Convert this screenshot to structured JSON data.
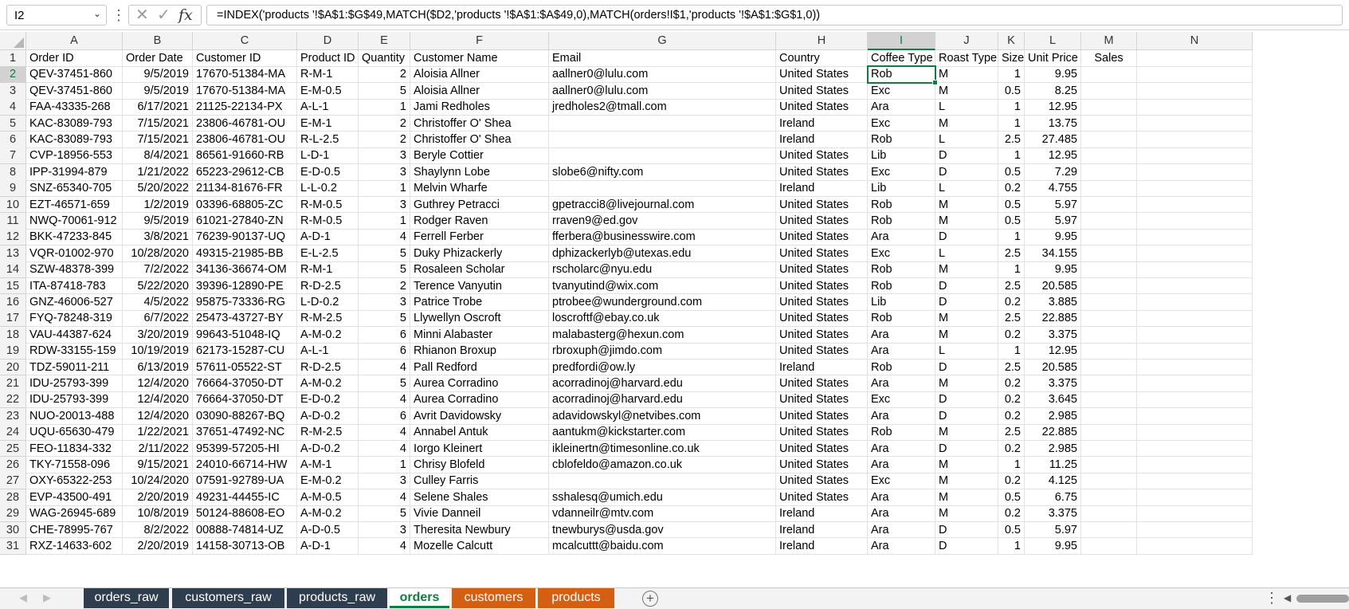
{
  "formula_bar": {
    "name_box": "I2",
    "formula": "=INDEX('products '!$A$1:$G$49,MATCH($D2,'products '!$A$1:$A$49,0),MATCH(orders!I$1,'products '!$A$1:$G$1,0))"
  },
  "icons": {
    "name_box_caret": "⌄",
    "more": "⋮",
    "cancel": "✕",
    "enter": "✓",
    "fx": "fx",
    "nav_prev": "◀",
    "nav_next": "▶",
    "add_sheet": "+",
    "tabs_more": "⋮",
    "scroll_left": "◀"
  },
  "grid": {
    "columns": [
      "A",
      "B",
      "C",
      "D",
      "E",
      "F",
      "G",
      "H",
      "I",
      "J",
      "K",
      "L",
      "M",
      "N"
    ],
    "selected_column": "I",
    "selected_row": 2,
    "header": [
      "Order ID",
      "Order Date",
      "Customer ID",
      "Product ID",
      "Quantity",
      "Customer Name",
      "Email",
      "Country",
      "Coffee Type",
      "Roast Type",
      "Size",
      "Unit Price",
      "Sales"
    ],
    "rows": [
      [
        "QEV-37451-860",
        "9/5/2019",
        "17670-51384-MA",
        "R-M-1",
        "2",
        "Aloisia Allner",
        "aallner0@lulu.com",
        "United States",
        "Rob",
        "M",
        "1",
        "9.95"
      ],
      [
        "QEV-37451-860",
        "9/5/2019",
        "17670-51384-MA",
        "E-M-0.5",
        "5",
        "Aloisia Allner",
        "aallner0@lulu.com",
        "United States",
        "Exc",
        "M",
        "0.5",
        "8.25"
      ],
      [
        "FAA-43335-268",
        "6/17/2021",
        "21125-22134-PX",
        "A-L-1",
        "1",
        "Jami Redholes",
        "jredholes2@tmall.com",
        "United States",
        "Ara",
        "L",
        "1",
        "12.95"
      ],
      [
        "KAC-83089-793",
        "7/15/2021",
        "23806-46781-OU",
        "E-M-1",
        "2",
        "Christoffer O' Shea",
        "",
        "Ireland",
        "Exc",
        "M",
        "1",
        "13.75"
      ],
      [
        "KAC-83089-793",
        "7/15/2021",
        "23806-46781-OU",
        "R-L-2.5",
        "2",
        "Christoffer O' Shea",
        "",
        "Ireland",
        "Rob",
        "L",
        "2.5",
        "27.485"
      ],
      [
        "CVP-18956-553",
        "8/4/2021",
        "86561-91660-RB",
        "L-D-1",
        "3",
        "Beryle Cottier",
        "",
        "United States",
        "Lib",
        "D",
        "1",
        "12.95"
      ],
      [
        "IPP-31994-879",
        "1/21/2022",
        "65223-29612-CB",
        "E-D-0.5",
        "3",
        "Shaylynn Lobe",
        "slobe6@nifty.com",
        "United States",
        "Exc",
        "D",
        "0.5",
        "7.29"
      ],
      [
        "SNZ-65340-705",
        "5/20/2022",
        "21134-81676-FR",
        "L-L-0.2",
        "1",
        "Melvin Wharfe",
        "",
        "Ireland",
        "Lib",
        "L",
        "0.2",
        "4.755"
      ],
      [
        "EZT-46571-659",
        "1/2/2019",
        "03396-68805-ZC",
        "R-M-0.5",
        "3",
        "Guthrey Petracci",
        "gpetracci8@livejournal.com",
        "United States",
        "Rob",
        "M",
        "0.5",
        "5.97"
      ],
      [
        "NWQ-70061-912",
        "9/5/2019",
        "61021-27840-ZN",
        "R-M-0.5",
        "1",
        "Rodger Raven",
        "rraven9@ed.gov",
        "United States",
        "Rob",
        "M",
        "0.5",
        "5.97"
      ],
      [
        "BKK-47233-845",
        "3/8/2021",
        "76239-90137-UQ",
        "A-D-1",
        "4",
        "Ferrell Ferber",
        "fferbera@businesswire.com",
        "United States",
        "Ara",
        "D",
        "1",
        "9.95"
      ],
      [
        "VQR-01002-970",
        "10/28/2020",
        "49315-21985-BB",
        "E-L-2.5",
        "5",
        "Duky Phizackerly",
        "dphizackerlyb@utexas.edu",
        "United States",
        "Exc",
        "L",
        "2.5",
        "34.155"
      ],
      [
        "SZW-48378-399",
        "7/2/2022",
        "34136-36674-OM",
        "R-M-1",
        "5",
        "Rosaleen Scholar",
        "rscholarc@nyu.edu",
        "United States",
        "Rob",
        "M",
        "1",
        "9.95"
      ],
      [
        "ITA-87418-783",
        "5/22/2020",
        "39396-12890-PE",
        "R-D-2.5",
        "2",
        "Terence Vanyutin",
        "tvanyutind@wix.com",
        "United States",
        "Rob",
        "D",
        "2.5",
        "20.585"
      ],
      [
        "GNZ-46006-527",
        "4/5/2022",
        "95875-73336-RG",
        "L-D-0.2",
        "3",
        "Patrice Trobe",
        "ptrobee@wunderground.com",
        "United States",
        "Lib",
        "D",
        "0.2",
        "3.885"
      ],
      [
        "FYQ-78248-319",
        "6/7/2022",
        "25473-43727-BY",
        "R-M-2.5",
        "5",
        "Llywellyn Oscroft",
        "loscroftf@ebay.co.uk",
        "United States",
        "Rob",
        "M",
        "2.5",
        "22.885"
      ],
      [
        "VAU-44387-624",
        "3/20/2019",
        "99643-51048-IQ",
        "A-M-0.2",
        "6",
        "Minni Alabaster",
        "malabasterg@hexun.com",
        "United States",
        "Ara",
        "M",
        "0.2",
        "3.375"
      ],
      [
        "RDW-33155-159",
        "10/19/2019",
        "62173-15287-CU",
        "A-L-1",
        "6",
        "Rhianon Broxup",
        "rbroxuph@jimdo.com",
        "United States",
        "Ara",
        "L",
        "1",
        "12.95"
      ],
      [
        "TDZ-59011-211",
        "6/13/2019",
        "57611-05522-ST",
        "R-D-2.5",
        "4",
        "Pall Redford",
        "predfordi@ow.ly",
        "Ireland",
        "Rob",
        "D",
        "2.5",
        "20.585"
      ],
      [
        "IDU-25793-399",
        "12/4/2020",
        "76664-37050-DT",
        "A-M-0.2",
        "5",
        "Aurea Corradino",
        "acorradinoj@harvard.edu",
        "United States",
        "Ara",
        "M",
        "0.2",
        "3.375"
      ],
      [
        "IDU-25793-399",
        "12/4/2020",
        "76664-37050-DT",
        "E-D-0.2",
        "4",
        "Aurea Corradino",
        "acorradinoj@harvard.edu",
        "United States",
        "Exc",
        "D",
        "0.2",
        "3.645"
      ],
      [
        "NUO-20013-488",
        "12/4/2020",
        "03090-88267-BQ",
        "A-D-0.2",
        "6",
        "Avrit Davidowsky",
        "adavidowskyl@netvibes.com",
        "United States",
        "Ara",
        "D",
        "0.2",
        "2.985"
      ],
      [
        "UQU-65630-479",
        "1/22/2021",
        "37651-47492-NC",
        "R-M-2.5",
        "4",
        "Annabel Antuk",
        "aantukm@kickstarter.com",
        "United States",
        "Rob",
        "M",
        "2.5",
        "22.885"
      ],
      [
        "FEO-11834-332",
        "2/11/2022",
        "95399-57205-HI",
        "A-D-0.2",
        "4",
        "Iorgo Kleinert",
        "ikleinertn@timesonline.co.uk",
        "United States",
        "Ara",
        "D",
        "0.2",
        "2.985"
      ],
      [
        "TKY-71558-096",
        "9/15/2021",
        "24010-66714-HW",
        "A-M-1",
        "1",
        "Chrisy Blofeld",
        "cblofeldo@amazon.co.uk",
        "United States",
        "Ara",
        "M",
        "1",
        "11.25"
      ],
      [
        "OXY-65322-253",
        "10/24/2020",
        "07591-92789-UA",
        "E-M-0.2",
        "3",
        "Culley Farris",
        "",
        "United States",
        "Exc",
        "M",
        "0.2",
        "4.125"
      ],
      [
        "EVP-43500-491",
        "2/20/2019",
        "49231-44455-IC",
        "A-M-0.5",
        "4",
        "Selene Shales",
        "sshalesq@umich.edu",
        "United States",
        "Ara",
        "M",
        "0.5",
        "6.75"
      ],
      [
        "WAG-26945-689",
        "10/8/2019",
        "50124-88608-EO",
        "A-M-0.2",
        "5",
        "Vivie Danneil",
        "vdanneilr@mtv.com",
        "Ireland",
        "Ara",
        "M",
        "0.2",
        "3.375"
      ],
      [
        "CHE-78995-767",
        "8/2/2022",
        "00888-74814-UZ",
        "A-D-0.5",
        "3",
        "Theresita Newbury",
        "tnewburys@usda.gov",
        "Ireland",
        "Ara",
        "D",
        "0.5",
        "5.97"
      ],
      [
        "RXZ-14633-602",
        "2/20/2019",
        "14158-30713-OB",
        "A-D-1",
        "4",
        "Mozelle Calcutt",
        "mcalcuttt@baidu.com",
        "Ireland",
        "Ara",
        "D",
        "1",
        "9.95"
      ]
    ]
  },
  "sheets": [
    {
      "name": "orders_raw",
      "color": "#2f3e4e",
      "active": false
    },
    {
      "name": "customers_raw",
      "color": "#2f3e4e",
      "active": false
    },
    {
      "name": "products_raw",
      "color": "#2f3e4e",
      "active": false
    },
    {
      "name": "orders",
      "color": "#ffffff",
      "active": true
    },
    {
      "name": "customers",
      "color": "#d35f12",
      "active": false
    },
    {
      "name": "products",
      "color": "#d35f12",
      "active": false
    }
  ],
  "colors": {
    "accent": "#107c41",
    "dark_tab": "#2f3e4e",
    "orange_tab": "#d35f12"
  }
}
